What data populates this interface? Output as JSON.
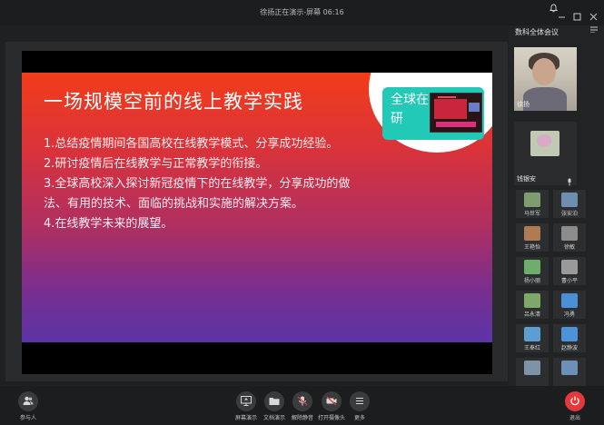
{
  "top_bar": {
    "title": "徐扬正在演示-屏幕 06:16",
    "icons": [
      "bell-icon",
      "minimize-icon",
      "maximize-icon",
      "close-icon"
    ]
  },
  "slide": {
    "title": "一场规模空前的线上教学实践",
    "points": [
      "1.总结疫情期间各国高校在线教学模式、分享成功经验。",
      "2.研讨疫情后在线教学与正常教学的衔接。",
      "3.全球高校深入探讨新冠疫情下的在线教学，分享成功的做法、有用的技术、面临的挑战和实施的解决方案。",
      "4.在线教学未来的展望。"
    ],
    "callout_text": "全球在\n研",
    "colors": {
      "top": "#f23c1a",
      "bottom": "#5b34a6",
      "callout": "#23c9b7"
    }
  },
  "panel": {
    "title": "数科全体会议",
    "speakers": [
      {
        "name": "徐扬"
      },
      {
        "name": "钱银安"
      }
    ],
    "participants": [
      {
        "name": "马世军",
        "color": "#7f9c6e"
      },
      {
        "name": "张安泊",
        "color": "#6e8fb0"
      },
      {
        "name": "王艳怡",
        "color": "#b07a52"
      },
      {
        "name": "徐敏",
        "color": "#8c8c8c"
      },
      {
        "name": "杨小丽",
        "color": "#6fae6a"
      },
      {
        "name": "曹小平",
        "color": "#9a9a9a"
      },
      {
        "name": "吕永清",
        "color": "#7da867"
      },
      {
        "name": "冯勇",
        "color": "#4a8fd8"
      },
      {
        "name": "王奉红",
        "color": "#5a9fd0"
      },
      {
        "name": "赵静波",
        "color": "#4c93d8"
      },
      {
        "name": "",
        "color": "#7f93a8"
      },
      {
        "name": "",
        "color": "#6d8fb8"
      }
    ]
  },
  "bottom_bar": {
    "participants_label": "参与人",
    "buttons": [
      {
        "label": "屏幕演示",
        "icon": "screen-share-icon"
      },
      {
        "label": "文档演示",
        "icon": "folder-icon"
      },
      {
        "label": "解除静音",
        "icon": "mic-muted-icon"
      },
      {
        "label": "打开摄像头",
        "icon": "camera-off-icon"
      },
      {
        "label": "更多",
        "icon": "more-icon"
      }
    ],
    "leave_label": "退出"
  }
}
